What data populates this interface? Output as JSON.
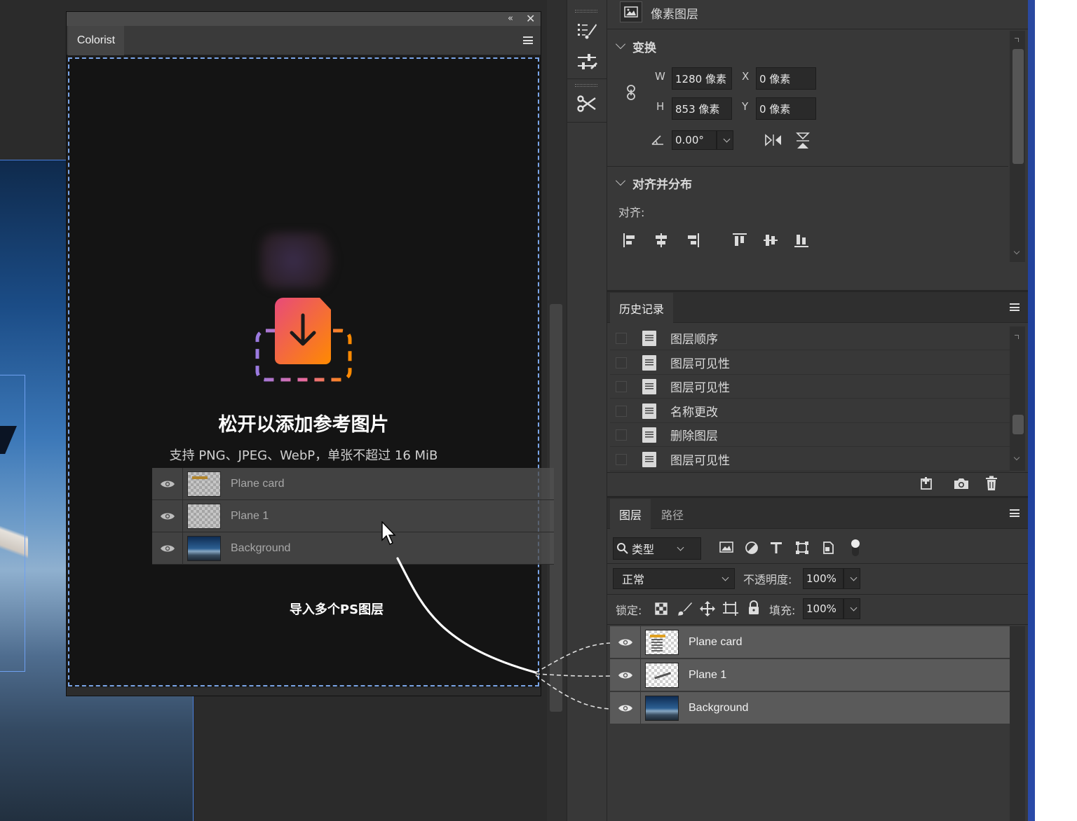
{
  "properties_panel": {
    "layer_type_label": "像素图层",
    "transform_section": {
      "title": "变换",
      "w_label": "W",
      "w_value": "1280 像素",
      "x_label": "X",
      "x_value": "0 像素",
      "h_label": "H",
      "h_value": "853 像素",
      "y_label": "Y",
      "y_value": "0 像素",
      "angle_value": "0.00°"
    },
    "align_section": {
      "title": "对齐并分布",
      "align_label": "对齐:"
    }
  },
  "history_panel": {
    "tab": "历史记录",
    "items": [
      {
        "label": "图层顺序"
      },
      {
        "label": "图层可见性"
      },
      {
        "label": "图层可见性"
      },
      {
        "label": "名称更改"
      },
      {
        "label": "删除图层"
      },
      {
        "label": "图层可见性"
      }
    ]
  },
  "layers_panel": {
    "tabs": [
      "图层",
      "路径"
    ],
    "filter_kind": "类型",
    "blend_mode": "正常",
    "opacity_label": "不透明度:",
    "opacity_value": "100%",
    "lock_label": "锁定:",
    "fill_label": "填充:",
    "fill_value": "100%",
    "layers": [
      {
        "name": "Plane card",
        "thumb": "checker-card"
      },
      {
        "name": "Plane 1",
        "thumb": "checker-plane"
      },
      {
        "name": "Background",
        "thumb": "sky"
      }
    ]
  },
  "colorist_panel": {
    "tab": "Colorist",
    "drop_title": "松开以添加参考图片",
    "drop_subtitle": "支持 PNG、JPEG、WebP，单张不超过 16 MiB",
    "annotation": "导入多个PS图层",
    "dragged_layers": [
      {
        "name": "Plane card"
      },
      {
        "name": "Plane 1"
      },
      {
        "name": "Background"
      }
    ]
  },
  "colors": {
    "drop_border": "#7aa5e8",
    "icon_gradient_start": "#e84a7a",
    "icon_gradient_end": "#ff8a00",
    "dash_gradient_start": "#9a7ae0"
  }
}
